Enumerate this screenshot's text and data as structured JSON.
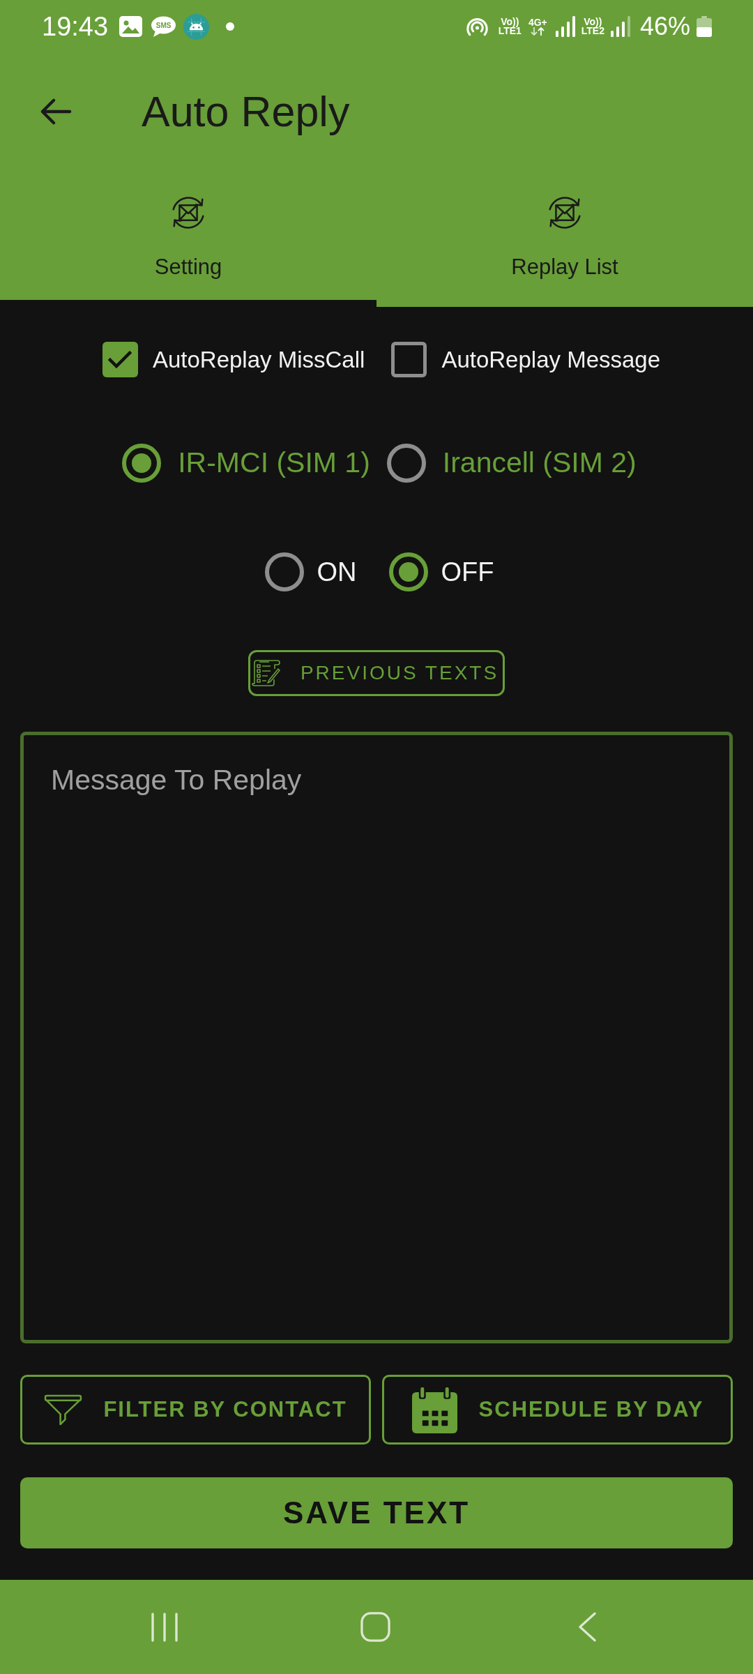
{
  "status_bar": {
    "time": "19:43",
    "sms_icon_text": "SMS",
    "volte": [
      {
        "top": "Vo))",
        "bottom": "LTE1"
      },
      {
        "top": "Vo))",
        "bottom": "LTE2"
      }
    ],
    "data_type": "4G+",
    "battery": "46%"
  },
  "app_bar": {
    "title": "Auto Reply"
  },
  "tabs": [
    {
      "label": "Setting",
      "selected": true
    },
    {
      "label": "Replay List",
      "selected": false
    }
  ],
  "checkboxes": [
    {
      "label": "AutoReplay MissCall",
      "checked": true
    },
    {
      "label": "AutoReplay Message",
      "checked": false
    }
  ],
  "sim_options": [
    {
      "label": "IR-MCI (SIM 1)",
      "selected": true
    },
    {
      "label": "Irancell (SIM 2)",
      "selected": false
    }
  ],
  "power_options": [
    {
      "label": "ON",
      "selected": false
    },
    {
      "label": "OFF",
      "selected": true
    }
  ],
  "previous_texts_button": {
    "label": "PREVIOUS TEXTS"
  },
  "message_field": {
    "placeholder": "Message To Replay"
  },
  "action_buttons": [
    {
      "kind": "filter",
      "label": "FILTER BY CONTACT"
    },
    {
      "kind": "schedule",
      "label": "SCHEDULE BY DAY"
    }
  ],
  "save_button": {
    "label": "SAVE TEXT"
  }
}
